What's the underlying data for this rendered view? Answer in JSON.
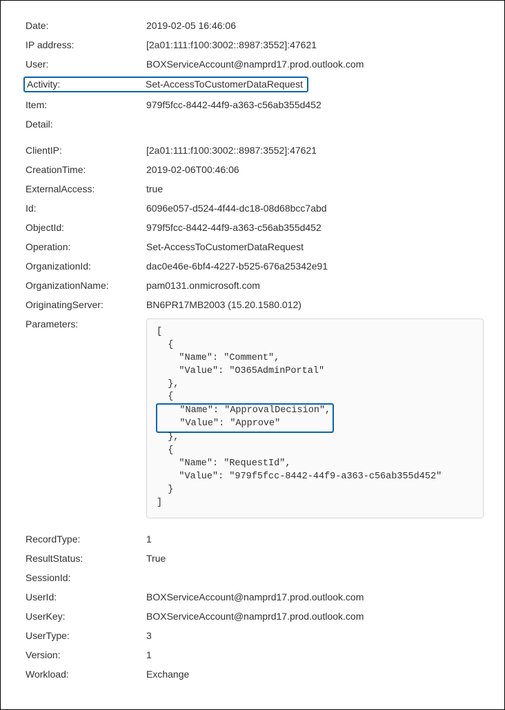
{
  "fields": {
    "date": {
      "label": "Date:",
      "value": "2019-02-05 16:46:06"
    },
    "ip": {
      "label": "IP address:",
      "value": "[2a01:111:f100:3002::8987:3552]:47621"
    },
    "user": {
      "label": "User:",
      "value": "BOXServiceAccount@namprd17.prod.outlook.com"
    },
    "activity": {
      "label": "Activity:",
      "value": "Set-AccessToCustomerDataRequest"
    },
    "item": {
      "label": "Item:",
      "value": "979f5fcc-8442-44f9-a363-c56ab355d452"
    },
    "detail": {
      "label": "Detail:",
      "value": ""
    },
    "clientip": {
      "label": "ClientIP:",
      "value": "[2a01:111:f100:3002::8987:3552]:47621"
    },
    "creationtime": {
      "label": "CreationTime:",
      "value": "2019-02-06T00:46:06"
    },
    "externalaccess": {
      "label": "ExternalAccess:",
      "value": "true"
    },
    "id": {
      "label": "Id:",
      "value": "6096e057-d524-4f44-dc18-08d68bcc7abd"
    },
    "objectid": {
      "label": "ObjectId:",
      "value": "979f5fcc-8442-44f9-a363-c56ab355d452"
    },
    "operation": {
      "label": "Operation:",
      "value": "Set-AccessToCustomerDataRequest"
    },
    "organizationid": {
      "label": "OrganizationId:",
      "value": "dac0e46e-6bf4-4227-b525-676a25342e91"
    },
    "organizationname": {
      "label": "OrganizationName:",
      "value": "pam0131.onmicrosoft.com"
    },
    "originatingserver": {
      "label": "OriginatingServer:",
      "value": "BN6PR17MB2003 (15.20.1580.012)"
    },
    "parameters": {
      "label": "Parameters:"
    },
    "recordtype": {
      "label": "RecordType:",
      "value": "1"
    },
    "resultstatus": {
      "label": "ResultStatus:",
      "value": "True"
    },
    "sessionid": {
      "label": "SessionId:",
      "value": ""
    },
    "userid": {
      "label": "UserId:",
      "value": "BOXServiceAccount@namprd17.prod.outlook.com"
    },
    "userkey": {
      "label": "UserKey:",
      "value": "BOXServiceAccount@namprd17.prod.outlook.com"
    },
    "usertype": {
      "label": "UserType:",
      "value": "3"
    },
    "version": {
      "label": "Version:",
      "value": "1"
    },
    "workload": {
      "label": "Workload:",
      "value": "Exchange"
    }
  },
  "code": {
    "l1": "[",
    "l2": "  {",
    "l3": "    \"Name\": \"Comment\",",
    "l4": "    \"Value\": \"O365AdminPortal\"",
    "l5": "  },",
    "l6": "  {",
    "hl1": "    \"Name\": \"ApprovalDecision\",",
    "hl2": "    \"Value\": \"Approve\"",
    "l9": "  },",
    "l10": "  {",
    "l11": "    \"Name\": \"RequestId\",",
    "l12": "    \"Value\": \"979f5fcc-8442-44f9-a363-c56ab355d452\"",
    "l13": "  }",
    "l14": "]"
  }
}
